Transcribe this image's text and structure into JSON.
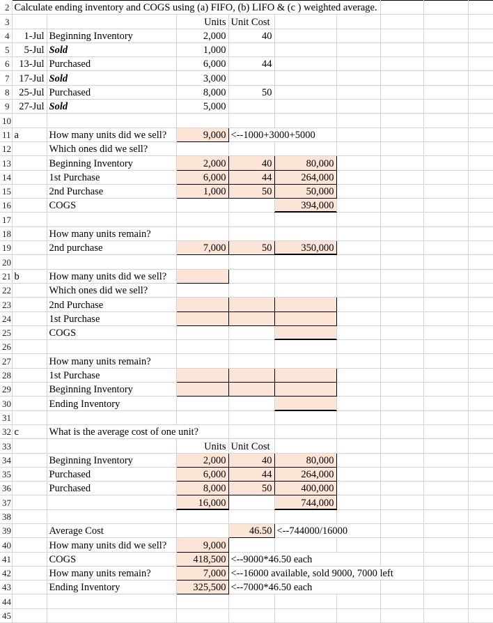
{
  "sheet": {
    "title_row": "Calculate ending inventory and COGS using (a) FIFO, (b) LIFO & (c ) weighted average.",
    "fill_color": "#fce4d6",
    "gridline_color": "#d4d4d4",
    "header_bg": "#e7e7e7"
  },
  "row_numbers": [
    "2",
    "3",
    "4",
    "5",
    "6",
    "7",
    "8",
    "9",
    "10",
    "11",
    "12",
    "13",
    "14",
    "15",
    "16",
    "17",
    "18",
    "19",
    "20",
    "21",
    "22",
    "23",
    "24",
    "25",
    "26",
    "27",
    "28",
    "29",
    "30",
    "31",
    "32",
    "33",
    "34",
    "35",
    "36",
    "37",
    "38",
    "39",
    "40",
    "41",
    "42",
    "43",
    "44",
    "45"
  ],
  "headers": {
    "units": "Units",
    "unit_cost": "Unit Cost"
  },
  "transactions": [
    {
      "date": "1-Jul",
      "desc": "Beginning Inventory",
      "units": "2,000",
      "cost": "40",
      "italic": false
    },
    {
      "date": "5-Jul",
      "desc": "Sold",
      "units": "1,000",
      "cost": "",
      "italic": true
    },
    {
      "date": "13-Jul",
      "desc": "Purchased",
      "units": "6,000",
      "cost": "44",
      "italic": false
    },
    {
      "date": "17-Jul",
      "desc": "Sold",
      "units": "3,000",
      "cost": "",
      "italic": true
    },
    {
      "date": "25-Jul",
      "desc": "Purchased",
      "units": "8,000",
      "cost": "50",
      "italic": false
    },
    {
      "date": "27-Jul",
      "desc": "Sold",
      "units": "5,000",
      "cost": "",
      "italic": true
    }
  ],
  "part_a": {
    "label": "a",
    "q_sold": "How many units did we sell?",
    "q_sold_value": "9,000",
    "q_sold_note": "<--1000+3000+5000",
    "which_ones": "Which ones did we sell?",
    "rows": [
      {
        "desc": "Beginning Inventory",
        "units": "2,000",
        "cost": "40",
        "amount": "80,000"
      },
      {
        "desc": "1st Purchase",
        "units": "6,000",
        "cost": "44",
        "amount": "264,000"
      },
      {
        "desc": "2nd Purchase",
        "units": "1,000",
        "cost": "50",
        "amount": "50,000"
      }
    ],
    "cogs_label": "COGS",
    "cogs_value": "394,000",
    "q_remain": "How many units remain?",
    "remain_row": {
      "desc": "2nd purchase",
      "units": "7,000",
      "cost": "50",
      "amount": "350,000"
    }
  },
  "part_b": {
    "label": "b",
    "q_sold": "How many units did we sell?",
    "q_sold_value": "",
    "which_ones": "Which ones did we sell?",
    "rows": [
      {
        "desc": "2nd Purchase",
        "units": "",
        "cost": "",
        "amount": ""
      },
      {
        "desc": "1st Purchase",
        "units": "",
        "cost": "",
        "amount": ""
      }
    ],
    "cogs_label": "COGS",
    "cogs_value": "",
    "q_remain": "How many units remain?",
    "remain_rows": [
      {
        "desc": "1st Purchase",
        "units": "",
        "cost": "",
        "amount": ""
      },
      {
        "desc": "Beginning Inventory",
        "units": "",
        "cost": "",
        "amount": ""
      }
    ],
    "ending_label": "Ending Inventory",
    "ending_value": ""
  },
  "part_c": {
    "label": "c",
    "question": "What is the average cost of one unit?",
    "headers": {
      "units": "Units",
      "unit_cost": "Unit Cost"
    },
    "rows": [
      {
        "desc": "Beginning Inventory",
        "units": "2,000",
        "cost": "40",
        "amount": "80,000"
      },
      {
        "desc": "Purchased",
        "units": "6,000",
        "cost": "44",
        "amount": "264,000"
      },
      {
        "desc": "Purchased",
        "units": "8,000",
        "cost": "50",
        "amount": "400,000"
      }
    ],
    "total": {
      "desc": "",
      "units": "16,000",
      "cost": "",
      "amount": "744,000"
    },
    "summary": [
      {
        "desc": "Average Cost",
        "units": "",
        "cost": "46.50",
        "note": "<--744000/16000"
      },
      {
        "desc": "How many units did we sell?",
        "units": "9,000",
        "cost": "",
        "note": ""
      },
      {
        "desc": "COGS",
        "units": "418,500",
        "cost": "",
        "note": "<--9000*46.50 each"
      },
      {
        "desc": "How many units remain?",
        "units": "7,000",
        "cost": "",
        "note": "<--16000 available, sold 9000, 7000 left"
      },
      {
        "desc": "Ending Inventory",
        "units": "325,500",
        "cost": "",
        "note": "<--7000*46.50 each"
      }
    ]
  }
}
